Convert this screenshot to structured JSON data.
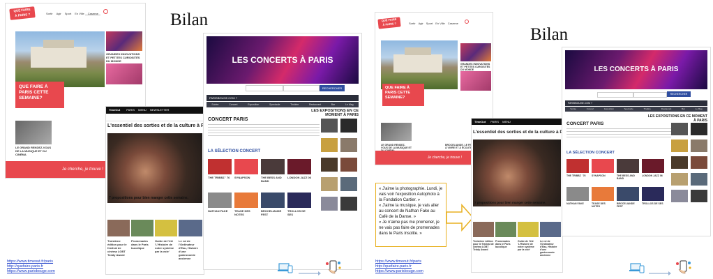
{
  "slide": {
    "bilan_left": "Bilan",
    "bilan_right": "Bilan"
  },
  "quefaire": {
    "logo_line1": "QUE FAIRE",
    "logo_line2": "À PARIS ?",
    "nav": [
      "Sortir",
      "Agir",
      "Sport",
      "En Ville",
      "Caserne"
    ],
    "hero_title": "QUE FAIRE À PARIS CETTE SEMAINE?",
    "side_caption": "GRANDES INNOVATIONS ET PETITES CURIOSITÉS DU MONDE",
    "bottom_left_caption": "LE GRAND RENDEZ-VOUS DE LA MUSIQUE ET DU CINÉMA",
    "bottom_mid_caption": "BROCELIANDE, LE FESTIVAL À VIVRE ET À ÉCOUTER",
    "footer": "Je cherche, je trouve !"
  },
  "timeout": {
    "brand": "TimeOut",
    "nav": [
      "PARIS",
      "MENU",
      "NEWSLETTER"
    ],
    "headline": "L'essentiel des sorties et de la culture à Paris",
    "feature_caption": "7 propositions pour bien manger cette semaine.",
    "cards": [
      "Troisième édition pour le festival de cinéma LGBT Teddy Award",
      "Promenades dans le Paris bucolique",
      "Guide de l'été 'L'Histoire de notre système par la voie'",
      "Le roi de l'Ordinateur d'Eau, Histoire d'une gastronomie ancienne"
    ]
  },
  "parisbouge": {
    "banner": "LES CONCERTS À PARIS",
    "search_button": "RECHERCHER",
    "bar_left": "PARISBOUGE.COM ?",
    "expo_title": "LES EXPOSITIONS EN CE MOMENT À PARIS",
    "concert_title": "CONCERT PARIS",
    "selection_title": "LA SÉLECTION CONCERT",
    "tabs": [
      "Soirée",
      "Concert",
      "Exposition",
      "Spectacle",
      "Théâtre",
      "Restaurant",
      "Bar",
      "Le Mag"
    ],
    "grid_labels": [
      "THE TRIBBZ ' 76",
      "SYNAPSON",
      "THE BESS AND BAND",
      "LONDON JAZZ 06",
      "NATHAN FAKE",
      "TEASE DES NOTES",
      "BROCELIANDE FEST",
      "TROLLOS DE SES"
    ]
  },
  "quote": {
    "lines": [
      "« J'aime la photographie. Lundi, je vais voir l'exposition Autophoto à la Fondation Cartier. »",
      "« J'aime la musique, je vais aller au concert de Nathan Fake au Café de la Danse. »",
      "« Je n'aime pas me promener, je ne vais pas faire de promenades dans le Paris insolite. »"
    ]
  },
  "links_left": [
    "https://www.timeout.fr/paris",
    "http://quefaire.paris.fr",
    "https://www.parisbouge.com"
  ],
  "links_right": [
    "https://www.timeout.fr/paris",
    "http://quefaire.paris.fr",
    "https://www.parisbouge.com"
  ],
  "colors": {
    "brand_red": "#e8484e",
    "arrow_yellow": "#e8b020",
    "link_blue": "#1a3cc8",
    "timeout_dark": "#111111",
    "pb_purple": "#6b1a6e"
  },
  "icons": [
    "laptop-phone-icon",
    "arrow-right-icon",
    "hand-phone-icon",
    "search-icon",
    "chevron-arrow-icon"
  ]
}
